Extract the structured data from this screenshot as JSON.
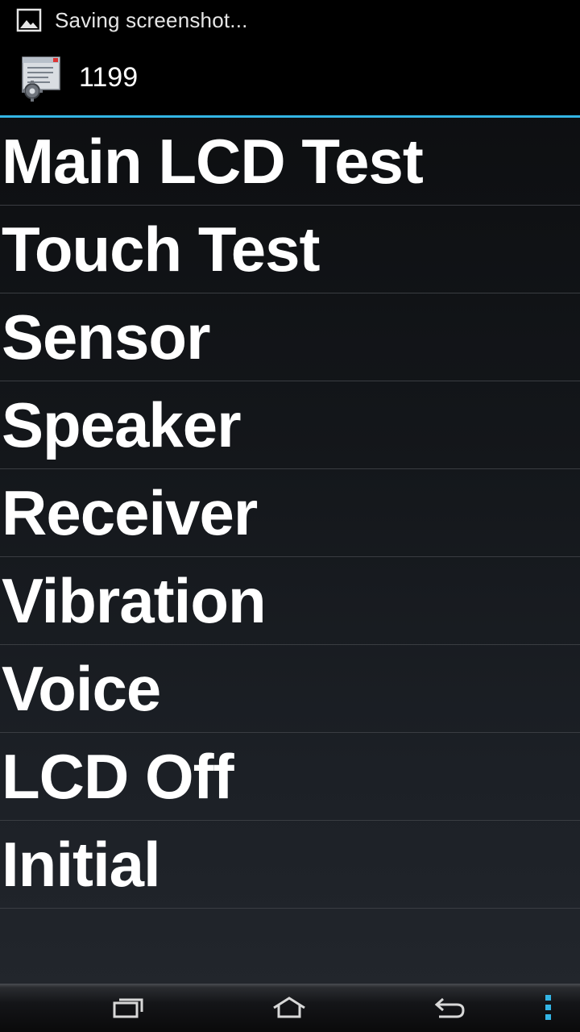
{
  "status_bar": {
    "notification_icon": "image-icon",
    "notification_text": "Saving screenshot..."
  },
  "action_bar": {
    "app_icon": "settings-document-icon",
    "title": "1199",
    "accent_color": "#33b5e5"
  },
  "menu": {
    "items": [
      {
        "label": "Main LCD Test"
      },
      {
        "label": "Touch Test"
      },
      {
        "label": "Sensor"
      },
      {
        "label": "Speaker"
      },
      {
        "label": "Receiver"
      },
      {
        "label": "Vibration"
      },
      {
        "label": "Voice"
      },
      {
        "label": "LCD Off"
      },
      {
        "label": "Initial"
      }
    ]
  },
  "nav_bar": {
    "buttons": [
      "recent-apps-icon",
      "home-icon",
      "back-icon",
      "overflow-menu-icon"
    ],
    "menu_color": "#33b5e5"
  }
}
